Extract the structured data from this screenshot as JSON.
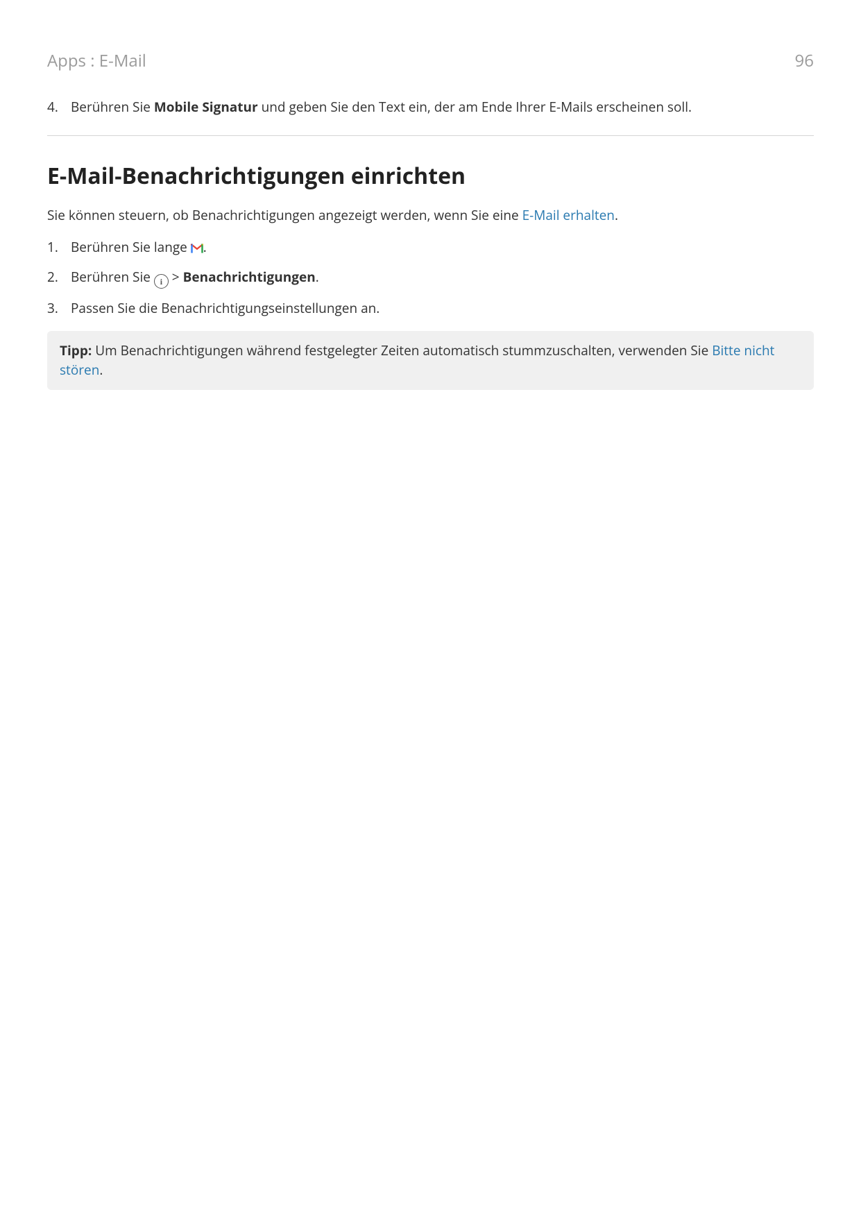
{
  "header": {
    "breadcrumb": "Apps : E-Mail",
    "page_number": "96"
  },
  "previous_section": {
    "step4_num": "4.",
    "step4_part1": "Berühren Sie ",
    "step4_bold": "Mobile Signatur",
    "step4_part2": " und geben Sie den Text ein, der am Ende Ihrer E-Mails erscheinen soll."
  },
  "section": {
    "title": "E-Mail-Benachrichtigungen einrichten",
    "intro_part1": "Sie können steuern, ob Benachrichtigungen angezeigt werden, wenn Sie eine ",
    "intro_link": "E-Mail erhalten",
    "intro_part2": "."
  },
  "steps": [
    {
      "num": "1.",
      "part1": "Berühren Sie lange ",
      "icon": "gmail-icon",
      "part2": "."
    },
    {
      "num": "2.",
      "part1": "Berühren Sie ",
      "icon": "info-icon",
      "separator": " > ",
      "bold": "Benachrichtigungen",
      "part2": "."
    },
    {
      "num": "3.",
      "part1": "Passen Sie die Benachrichtigungseinstellungen an."
    }
  ],
  "tip": {
    "label": "Tipp:",
    "part1": " Um Benachrichtigungen während festgelegter Zeiten automatisch stummzuschalten, verwenden Sie ",
    "link": "Bitte nicht stören",
    "part2": "."
  }
}
